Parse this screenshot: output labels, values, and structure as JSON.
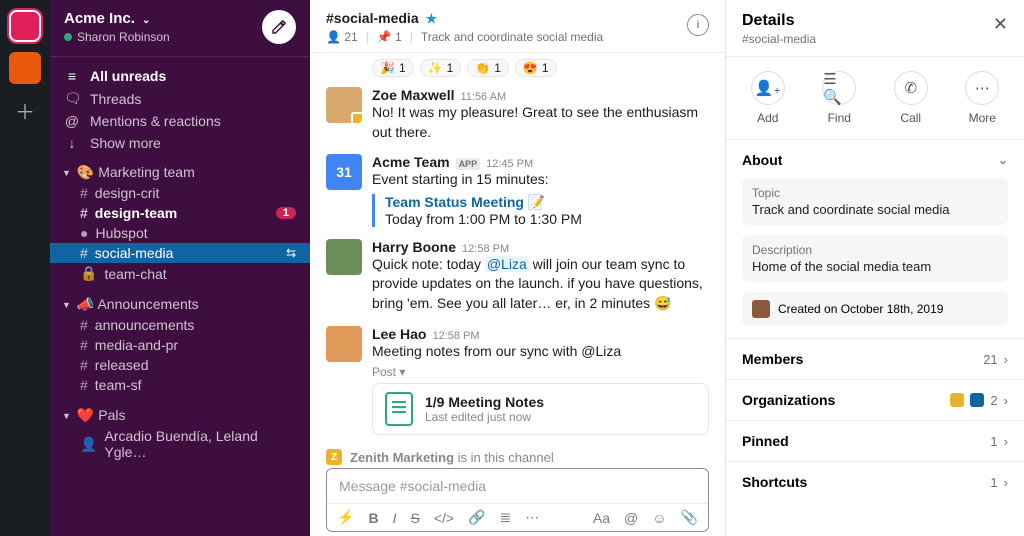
{
  "workspace": {
    "name": "Acme Inc.",
    "user": "Sharon Robinson"
  },
  "nav": {
    "all_unreads": "All unreads",
    "threads": "Threads",
    "mentions": "Mentions & reactions",
    "show_more": "Show more"
  },
  "sections": {
    "marketing": {
      "label": "🎨 Marketing team",
      "channels": [
        {
          "prefix": "#",
          "name": "design-crit"
        },
        {
          "prefix": "#",
          "name": "design-team",
          "unread": true,
          "badge": "1"
        },
        {
          "prefix": "●",
          "name": "Hubspot"
        },
        {
          "prefix": "#",
          "name": "social-media",
          "selected": true
        },
        {
          "prefix": "🔒",
          "name": "team-chat"
        }
      ]
    },
    "announcements": {
      "label": "📣 Announcements",
      "channels": [
        {
          "prefix": "#",
          "name": "announcements"
        },
        {
          "prefix": "#",
          "name": "media-and-pr"
        },
        {
          "prefix": "#",
          "name": "released"
        },
        {
          "prefix": "#",
          "name": "team-sf"
        }
      ]
    },
    "pals": {
      "label": "❤️ Pals",
      "dm": "Arcadio Buendía, Leland Ygle…"
    }
  },
  "header": {
    "channel": "#social-media",
    "members_icon_count": "21",
    "pins_count": "1",
    "topic": "Track and coordinate social media"
  },
  "reactions": [
    {
      "emoji": "🎉",
      "count": "1"
    },
    {
      "emoji": "✨",
      "count": "1"
    },
    {
      "emoji": "👏",
      "count": "1"
    },
    {
      "emoji": "😍",
      "count": "1"
    }
  ],
  "messages": {
    "zoe": {
      "name": "Zoe Maxwell",
      "time": "11:56 AM",
      "body": "No! It was my pleasure! Great to see the enthusiasm out there."
    },
    "acme": {
      "name": "Acme Team",
      "tag": "APP",
      "time": "12:45 PM",
      "body": "Event starting in 15 minutes:",
      "event_title": "Team Status Meeting 📝",
      "event_when": "Today from 1:00 PM to 1:30 PM"
    },
    "harry": {
      "name": "Harry Boone",
      "time": "12:58 PM",
      "body_pre": "Quick note: today ",
      "mention": "@Liza",
      "body_post": " will join our team sync to provide updates on the launch. if you have questions, bring 'em. See you all later… er, in 2 minutes 😅"
    },
    "lee": {
      "name": "Lee Hao",
      "time": "12:58 PM",
      "body": "Meeting notes from our sync with @Liza",
      "post_label": "Post ▾",
      "doc_title": "1/9 Meeting Notes",
      "doc_sub": "Last edited just now"
    }
  },
  "zenith": {
    "name": "Zenith Marketing",
    "suffix": " is in this channel"
  },
  "composer": {
    "placeholder": "Message #social-media"
  },
  "details": {
    "title": "Details",
    "sub": "#social-media",
    "actions": {
      "add": "Add",
      "find": "Find",
      "call": "Call",
      "more": "More"
    },
    "about_label": "About",
    "topic_label": "Topic",
    "topic_value": "Track and coordinate social media",
    "desc_label": "Description",
    "desc_value": "Home of the social media team",
    "created": "Created on October 18th, 2019",
    "members_label": "Members",
    "members_count": "21",
    "orgs_label": "Organizations",
    "orgs_count": "2",
    "pinned_label": "Pinned",
    "pinned_count": "1",
    "shortcuts_label": "Shortcuts",
    "shortcuts_count": "1"
  }
}
